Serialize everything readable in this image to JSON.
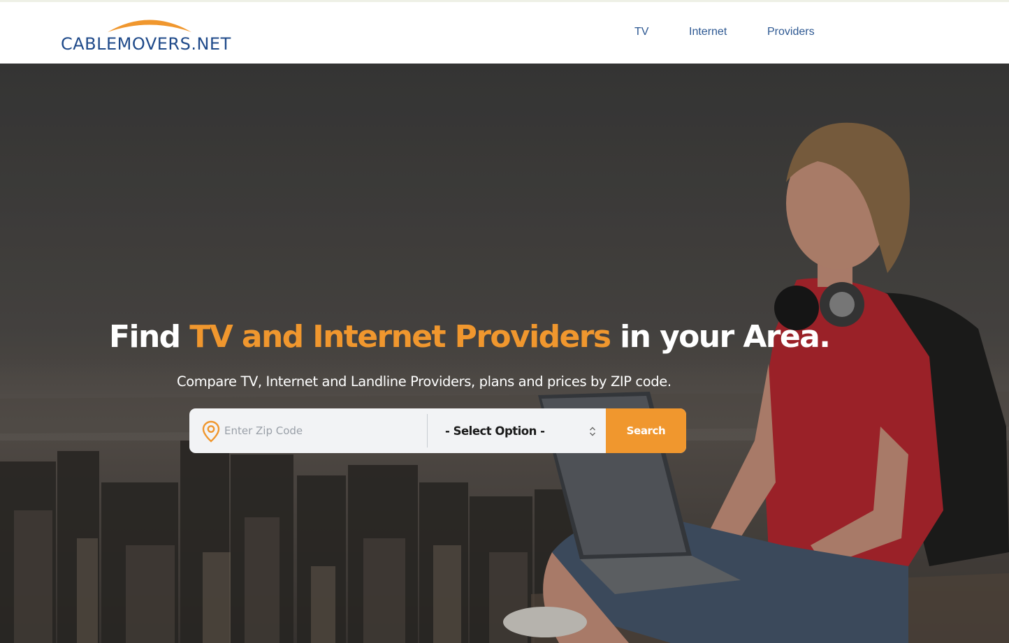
{
  "brand": {
    "logo_text": "CABLEMOVERS.NET",
    "primary_color": "#1f4a8a",
    "accent_color": "#f0972e"
  },
  "nav": {
    "items": [
      {
        "label": "TV"
      },
      {
        "label": "Internet"
      },
      {
        "label": "Providers"
      }
    ]
  },
  "hero": {
    "headline_before": "Find ",
    "headline_accent": "TV and Internet Providers",
    "headline_after": " in your Area.",
    "subheadline": "Compare TV, Internet and Landline Providers, plans and prices by ZIP code.",
    "background_image": "woman-with-laptop-and-headphones-on-rooftop-over-city"
  },
  "search": {
    "zip_placeholder": "Enter Zip Code",
    "zip_value": "",
    "zip_icon": "location-pin-icon",
    "select_value": "- Select Option -",
    "select_icon": "up-down-chevron-icon",
    "button_label": "Search"
  }
}
